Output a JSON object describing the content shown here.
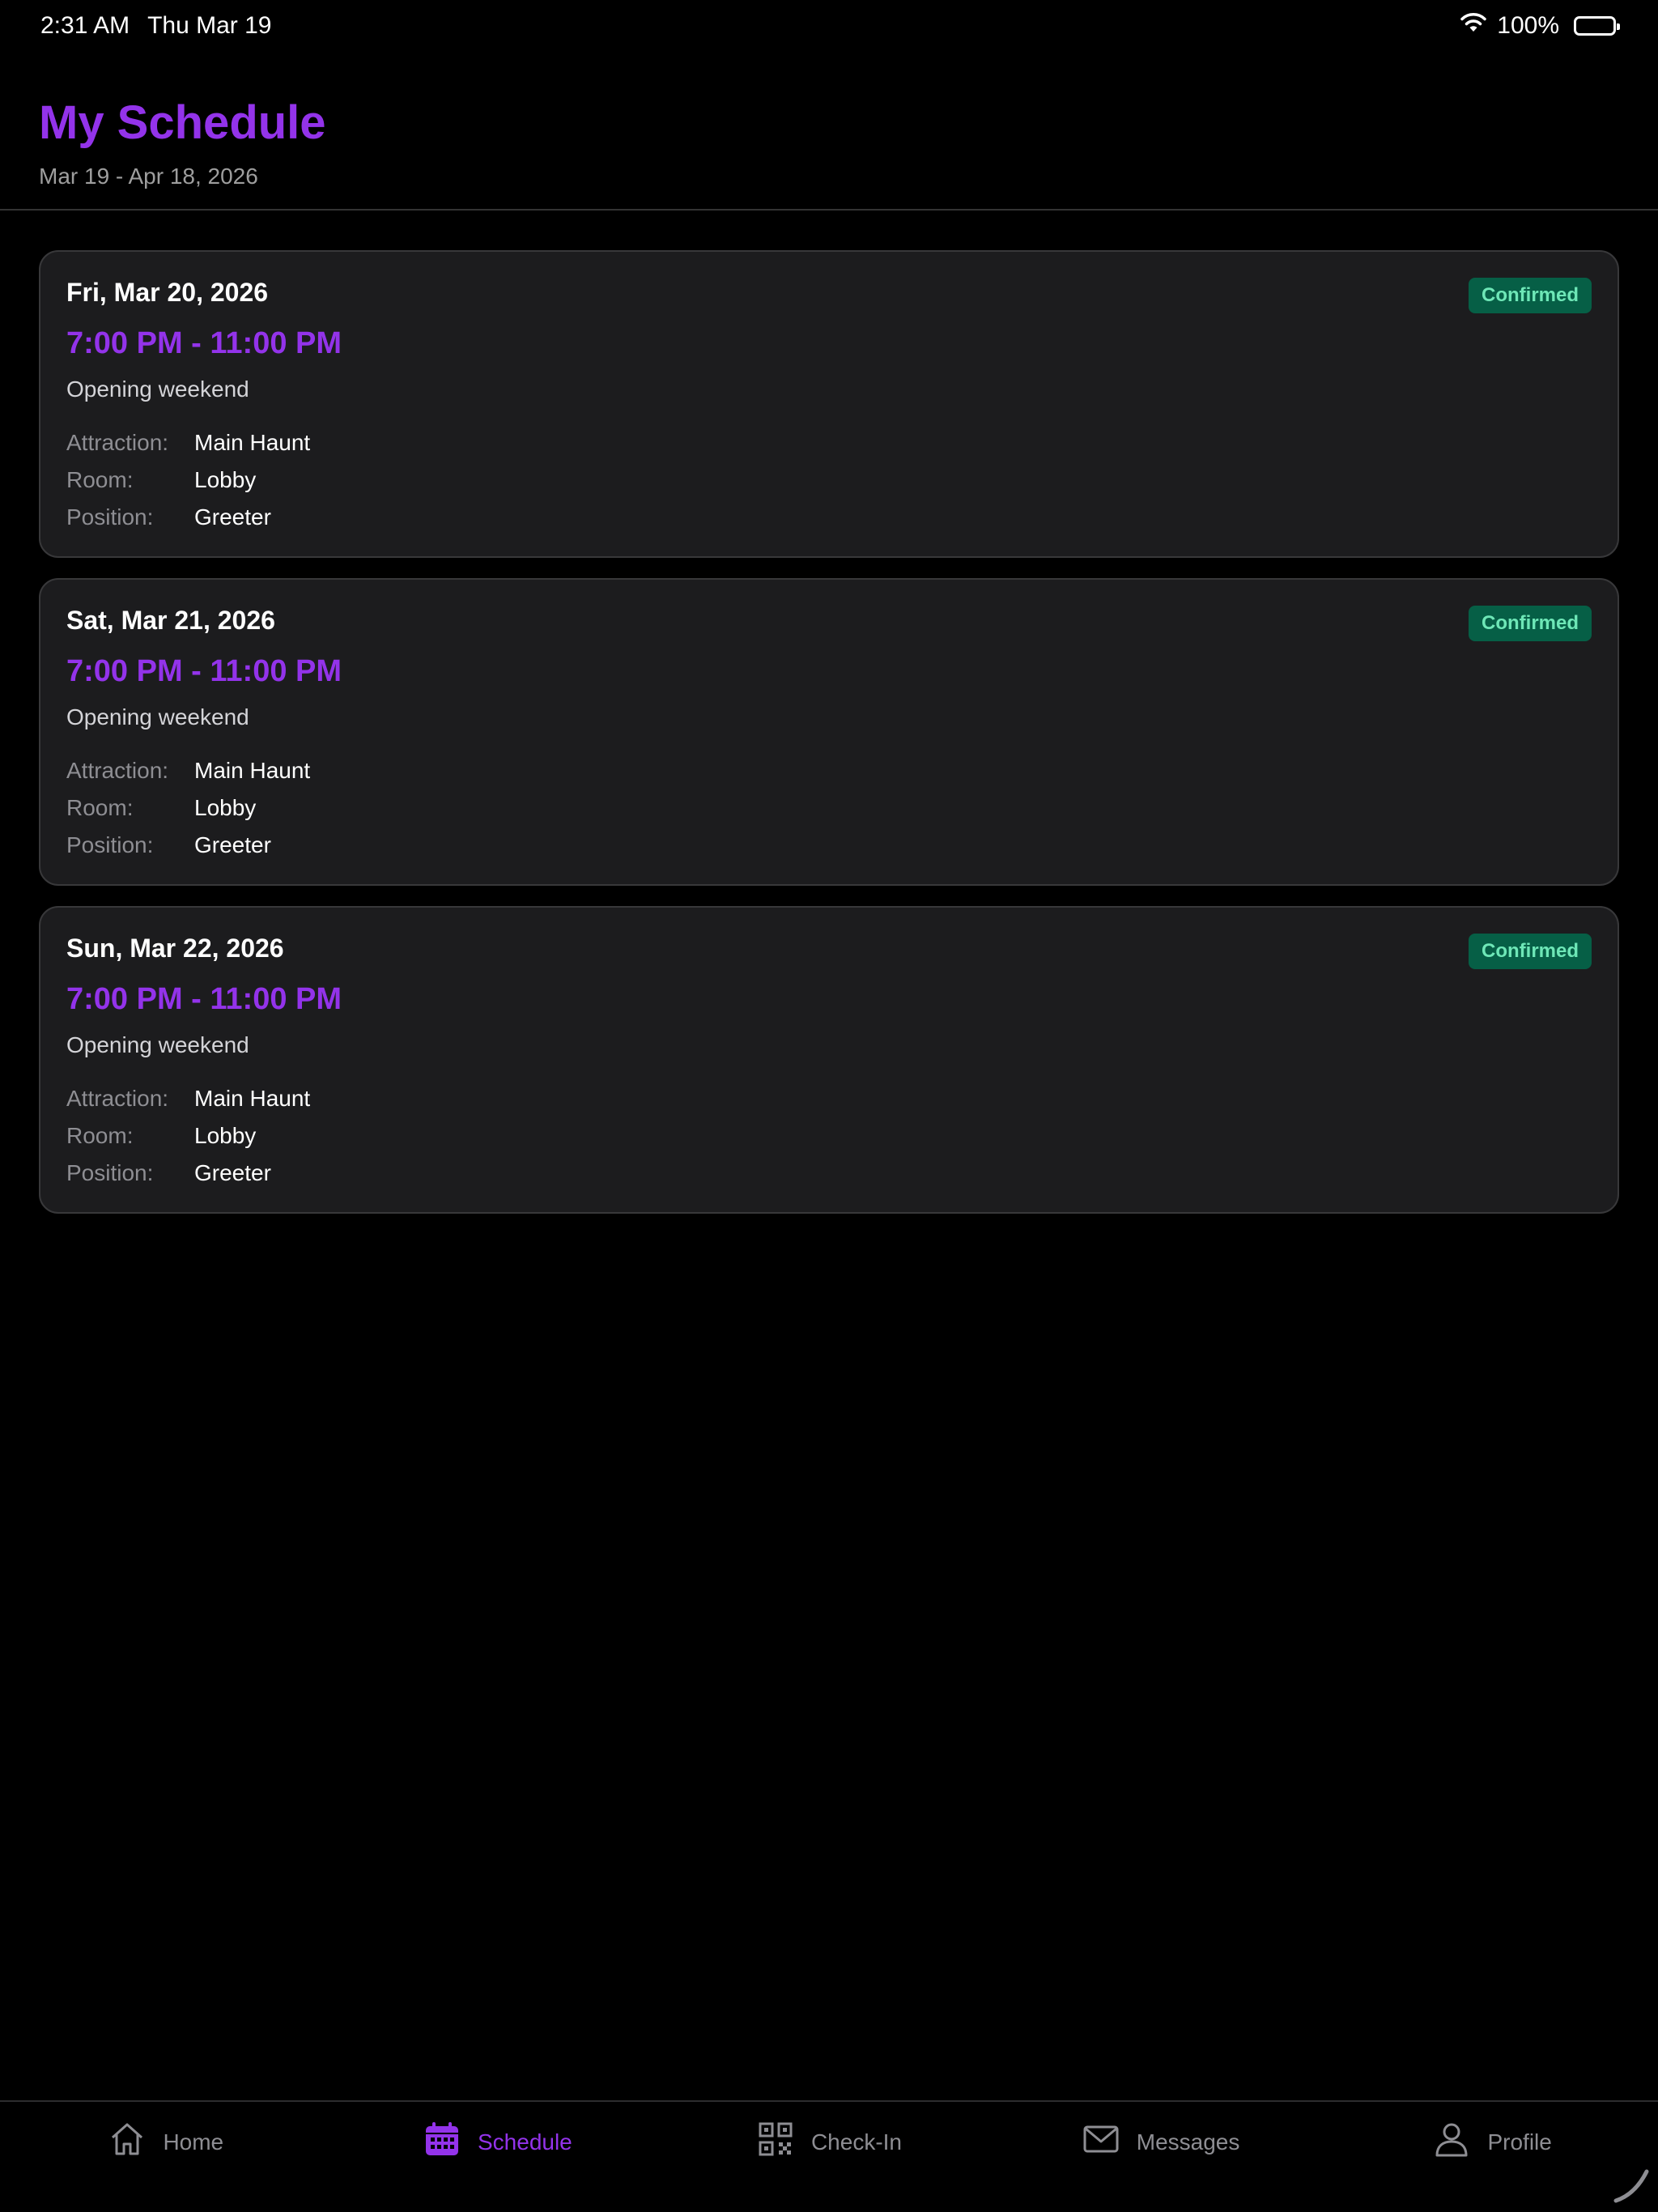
{
  "status_bar": {
    "time": "2:31 AM",
    "date": "Thu Mar 19",
    "battery": "100%"
  },
  "header": {
    "title": "My Schedule",
    "range": "Mar 19 - Apr 18, 2026"
  },
  "labels": {
    "attraction": "Attraction:",
    "room": "Room:",
    "position": "Position:"
  },
  "shifts": [
    {
      "date": "Fri, Mar 20, 2026",
      "time": "7:00 PM - 11:00 PM",
      "note": "Opening weekend",
      "status": "Confirmed",
      "attraction": "Main Haunt",
      "room": "Lobby",
      "position": "Greeter"
    },
    {
      "date": "Sat, Mar 21, 2026",
      "time": "7:00 PM - 11:00 PM",
      "note": "Opening weekend",
      "status": "Confirmed",
      "attraction": "Main Haunt",
      "room": "Lobby",
      "position": "Greeter"
    },
    {
      "date": "Sun, Mar 22, 2026",
      "time": "7:00 PM - 11:00 PM",
      "note": "Opening weekend",
      "status": "Confirmed",
      "attraction": "Main Haunt",
      "room": "Lobby",
      "position": "Greeter"
    }
  ],
  "tabs": [
    {
      "label": "Home",
      "icon": "home-icon"
    },
    {
      "label": "Schedule",
      "icon": "calendar-icon",
      "active": true
    },
    {
      "label": "Check-In",
      "icon": "qr-code-icon"
    },
    {
      "label": "Messages",
      "icon": "mail-icon"
    },
    {
      "label": "Profile",
      "icon": "person-icon"
    }
  ],
  "colors": {
    "accent": "#9333ea",
    "badge_bg": "#065f46",
    "badge_text": "#6ee7b7",
    "card_bg": "#1c1c1e"
  }
}
